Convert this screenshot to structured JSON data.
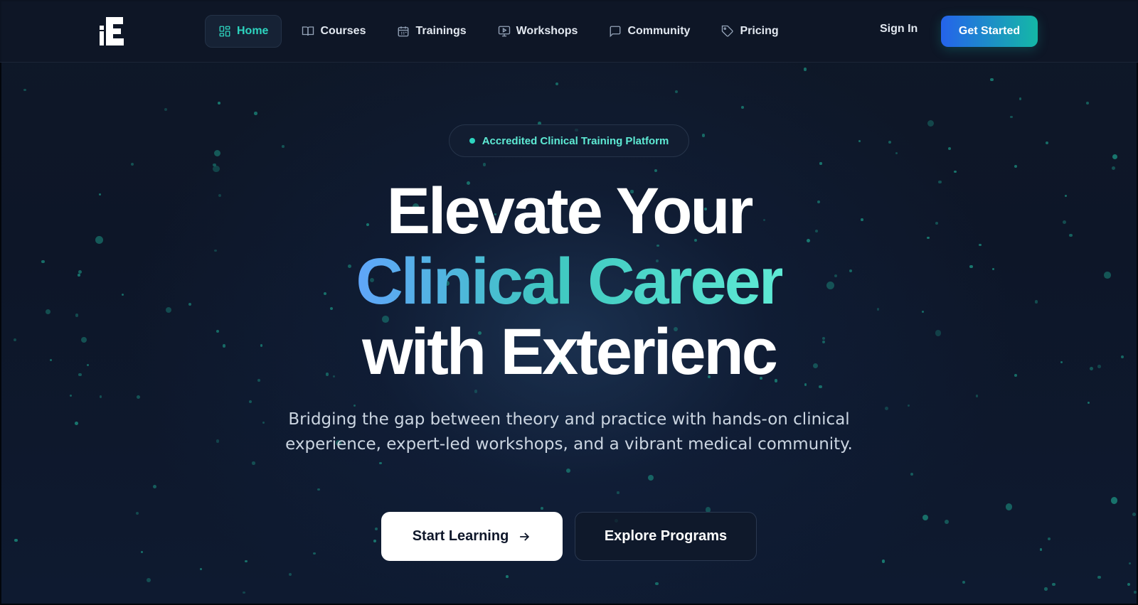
{
  "nav": {
    "logo_icon": "exterience-logo-icon",
    "links": [
      {
        "label": "Home",
        "icon": "grid-icon",
        "active": true
      },
      {
        "label": "Courses",
        "icon": "book-icon",
        "active": false
      },
      {
        "label": "Trainings",
        "icon": "calendar-icon",
        "active": false
      },
      {
        "label": "Workshops",
        "icon": "monitor-play-icon",
        "active": false
      },
      {
        "label": "Community",
        "icon": "chat-bubble-icon",
        "active": false
      },
      {
        "label": "Pricing",
        "icon": "tag-icon",
        "active": false
      }
    ],
    "sign_in": "Sign In",
    "get_started": "Get Started"
  },
  "hero": {
    "badge": "Accredited Clinical Training Platform",
    "headline_line1": "Elevate Your",
    "headline_line2": "Clinical Career",
    "headline_line3": "with Exterienc",
    "subtitle": "Bridging the gap between theory and practice with hands-on clinical experience, expert-led workshops, and a vibrant medical community.",
    "primary_button": "Start Learning",
    "primary_button_icon": "arrow-right-icon",
    "secondary_button": "Explore Programs"
  },
  "colors": {
    "background": "#0c1424",
    "accent_teal": "#2dd4bf",
    "accent_blue": "#2563eb",
    "gradient_text_start": "#60a5fa",
    "gradient_text_end": "#5eead4"
  }
}
